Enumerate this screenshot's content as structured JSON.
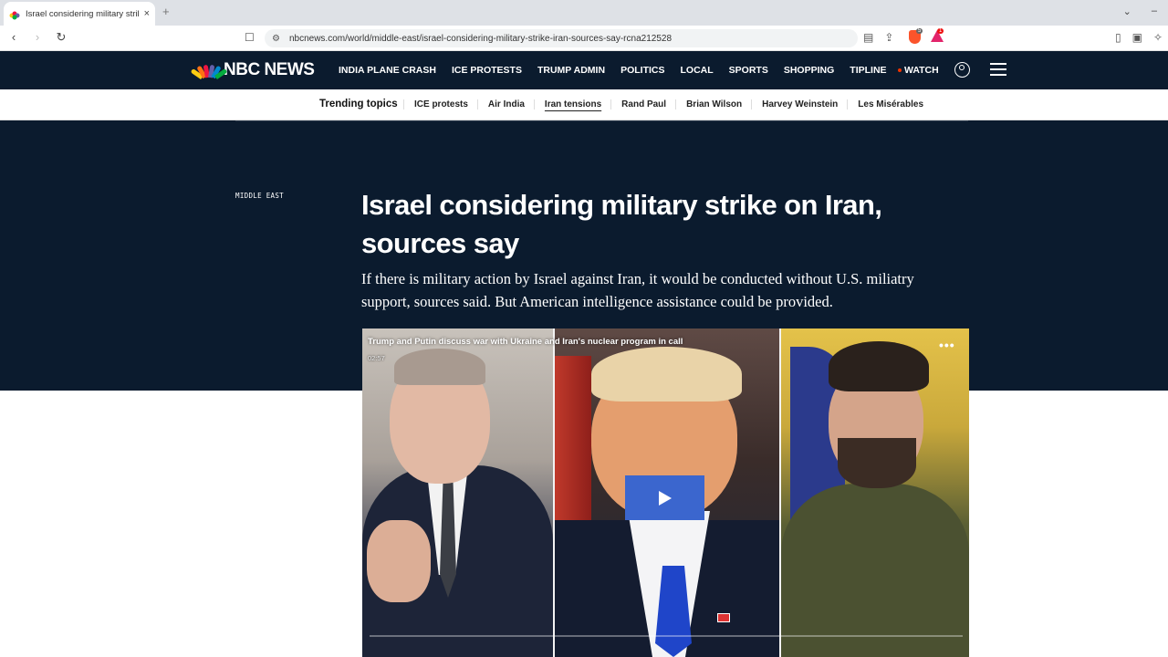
{
  "browser": {
    "tab_title": "Israel considering military strike",
    "new_tab_glyph": "+",
    "close_glyph": "×",
    "url": "nbcnews.com/world/middle-east/israel-considering-military-strike-iran-sources-say-rcna212528",
    "shields_count": "5",
    "rewards_count": "1"
  },
  "header": {
    "logo_text": "NBC NEWS",
    "nav": [
      "INDIA PLANE CRASH",
      "ICE PROTESTS",
      "TRUMP ADMIN",
      "POLITICS",
      "LOCAL",
      "SPORTS",
      "SHOPPING",
      "TIPLINE"
    ],
    "watch_label": "WATCH"
  },
  "trending": {
    "label": "Trending topics",
    "items": [
      "ICE protests",
      "Air India",
      "Iran tensions",
      "Rand Paul",
      "Brian Wilson",
      "Harvey Weinstein",
      "Les Misérables"
    ],
    "active": "Iran tensions"
  },
  "article": {
    "section": "MIDDLE EAST",
    "headline": "Israel considering military strike on Iran, sources say",
    "dek": "If there is military action by Israel against Iran, it would be conducted without U.S. miliatry support, sources said. But American intelligence assistance could be provided."
  },
  "video": {
    "title": "Trump and Putin discuss war with Ukraine and Iran's nuclear program in call",
    "duration": "02:57",
    "menu_glyph": "•••"
  },
  "colors": {
    "navy": "#0b1b2e",
    "play_blue": "#3b66ce"
  }
}
